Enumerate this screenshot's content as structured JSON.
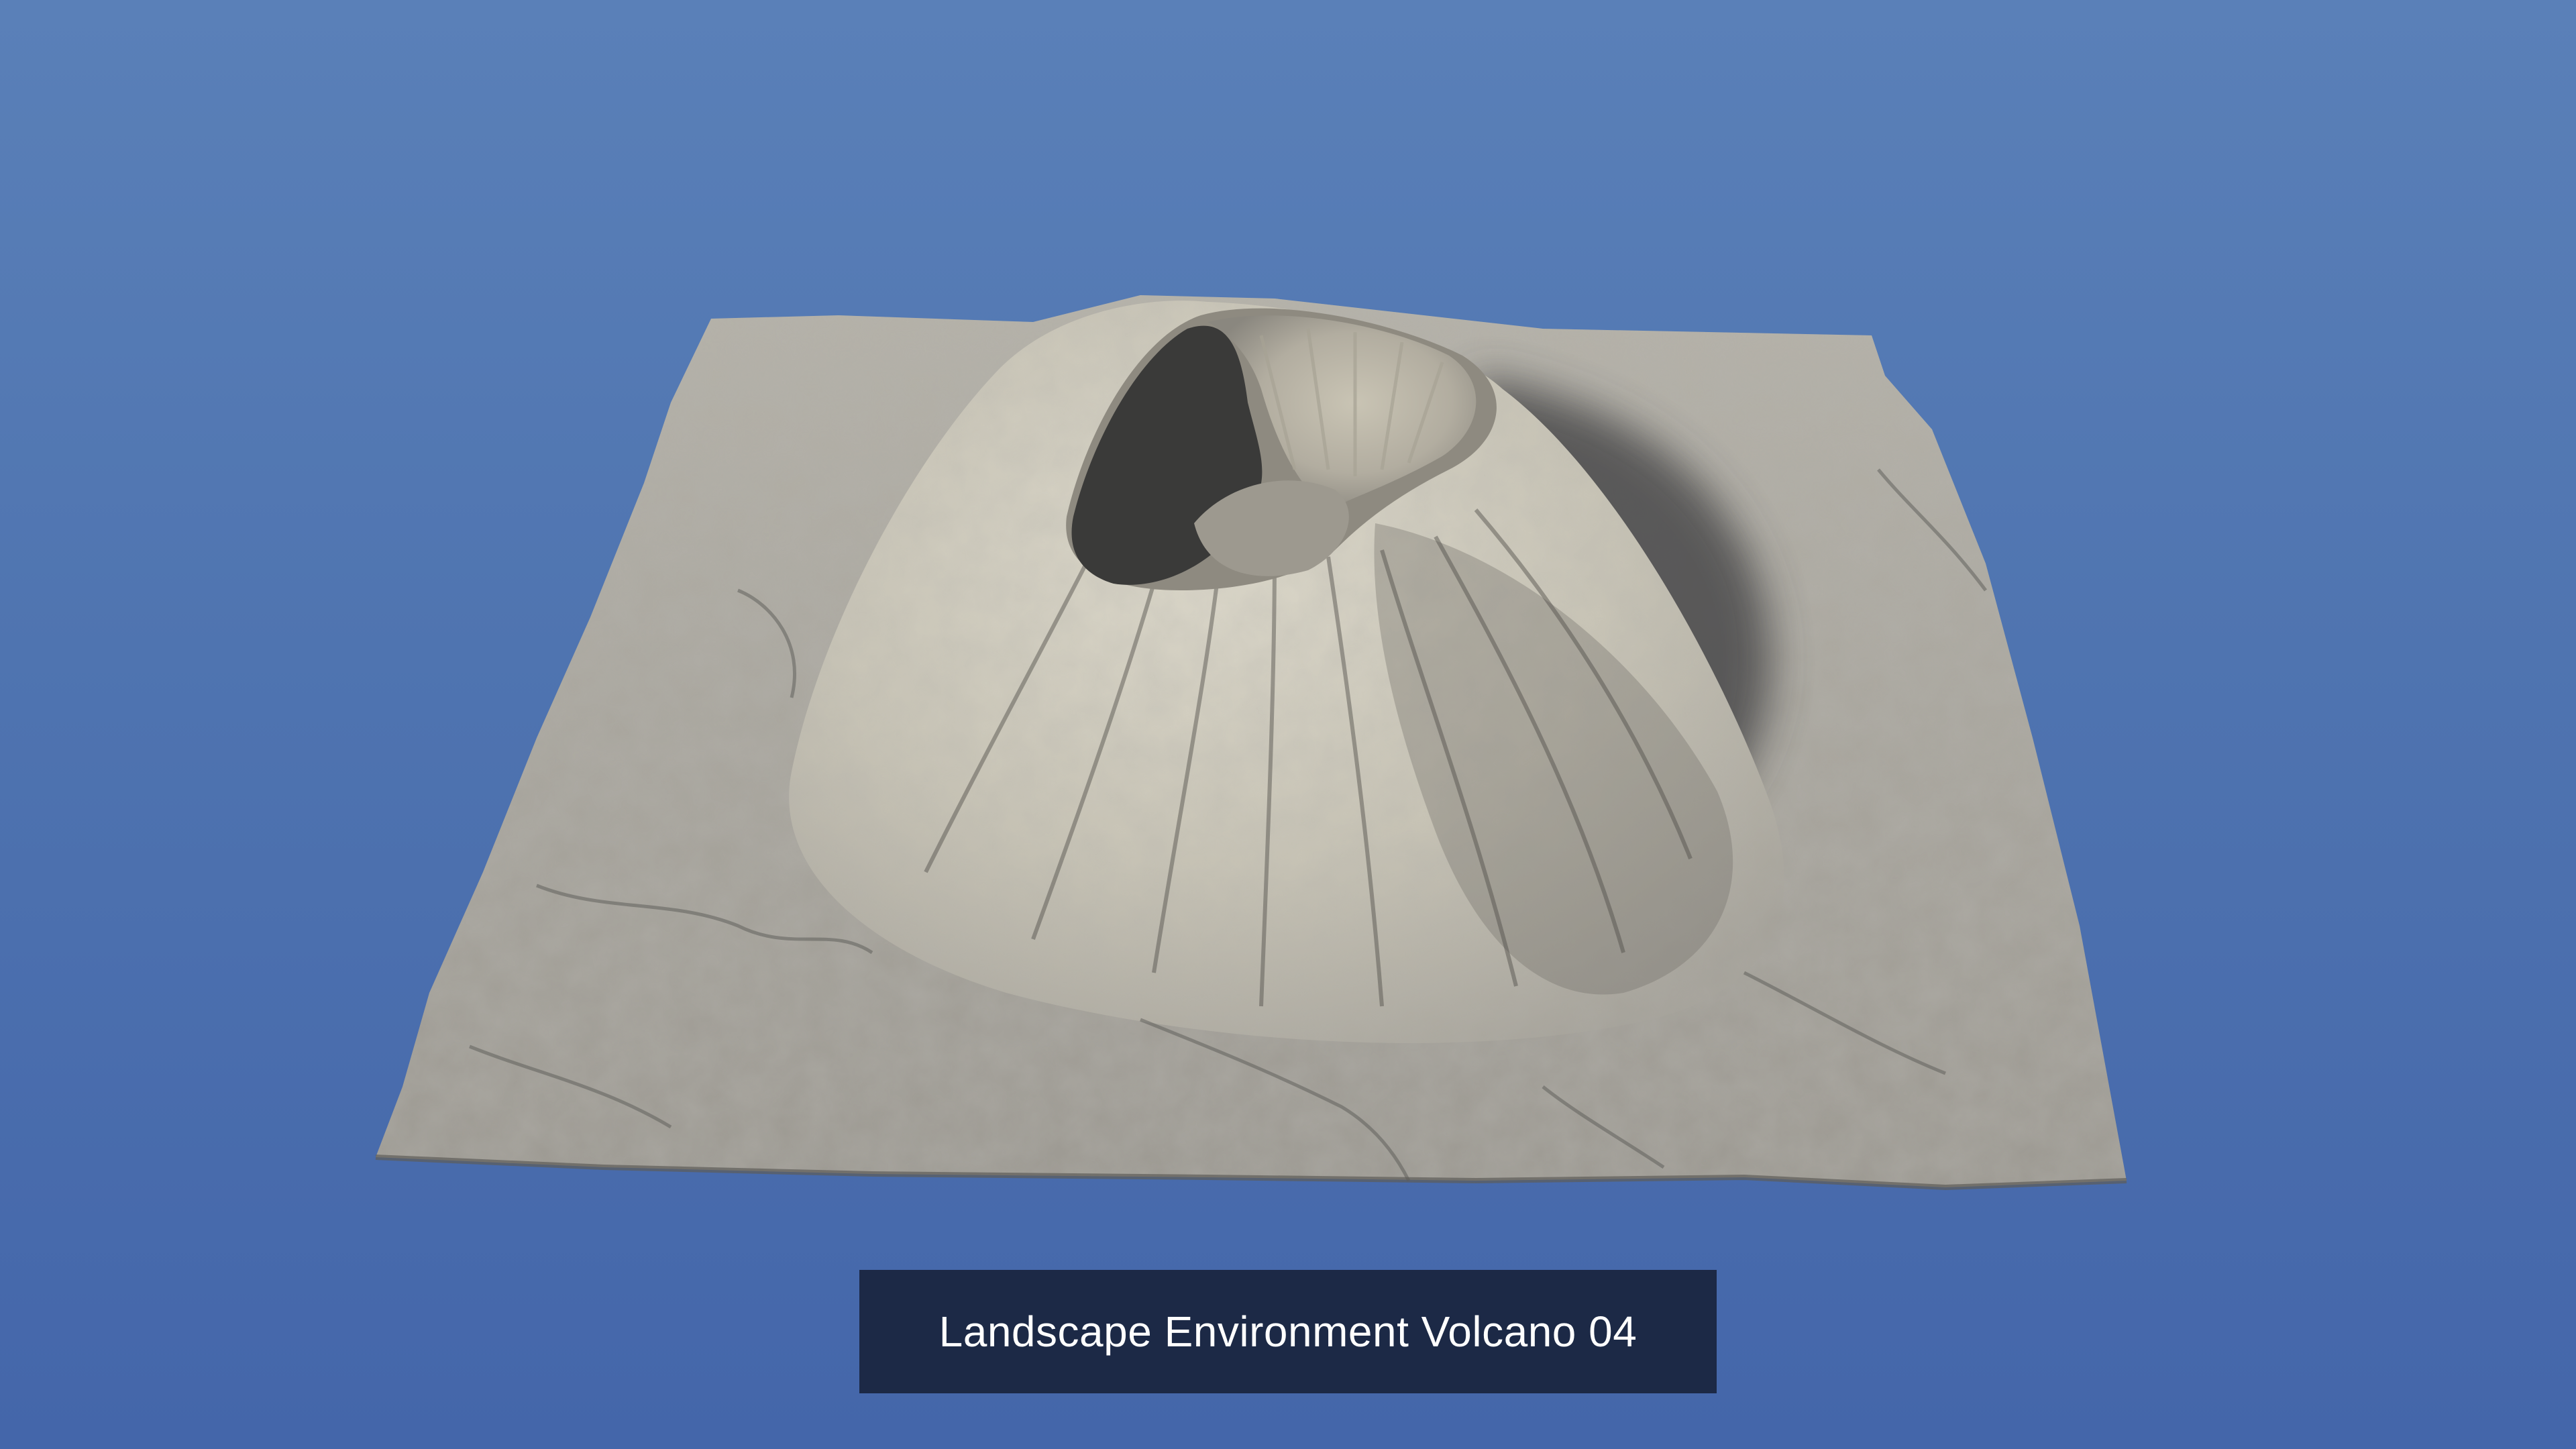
{
  "caption": {
    "text": "Landscape Environment Volcano 04"
  },
  "scene": {
    "subject-icon": "volcano-terrain-render",
    "colors": {
      "sky_top": "#5a80b8",
      "sky_bottom": "#4466aa",
      "rock_light": "#d8d4c6",
      "rock_mid": "#a8a59c",
      "rock_shadow": "#3f3f3e",
      "caption_bg": "#1c2946",
      "caption_text": "#ffffff"
    }
  }
}
